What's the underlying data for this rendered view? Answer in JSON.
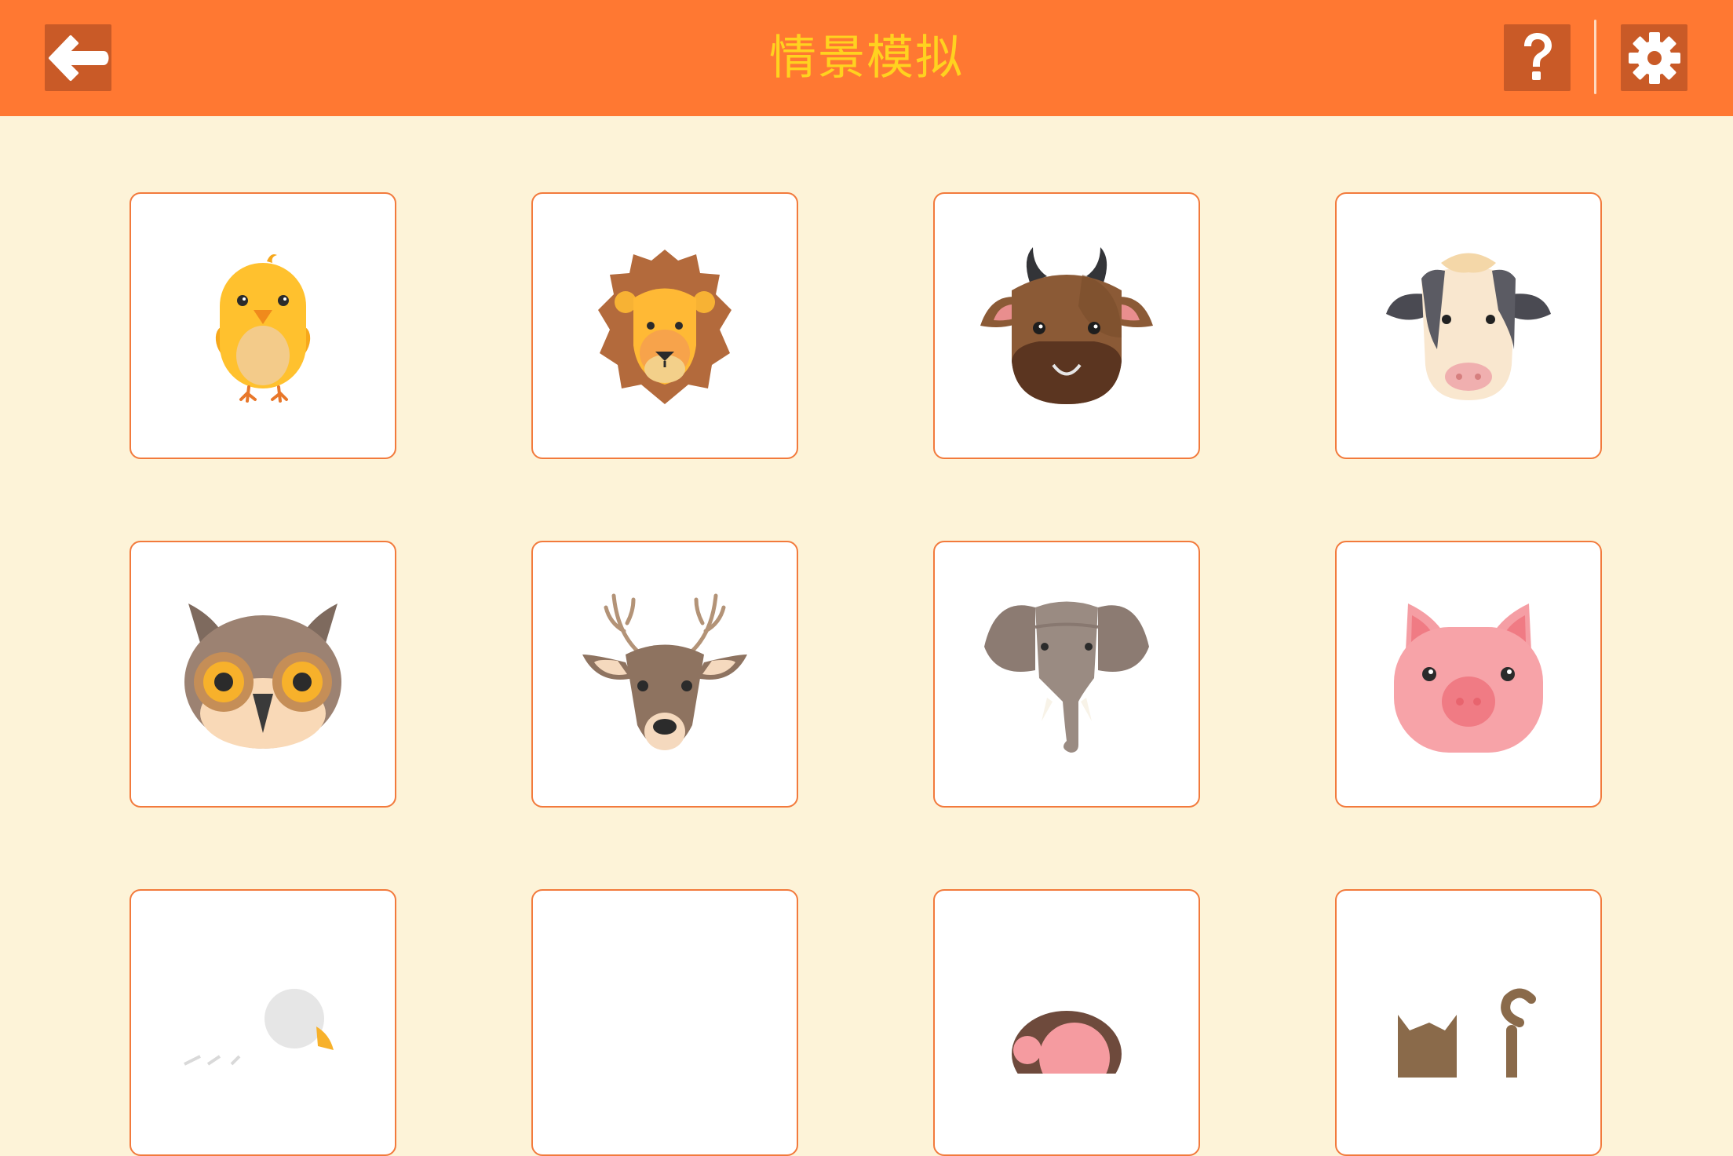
{
  "header": {
    "title": "情景模拟",
    "back_icon": "back-arrow-icon",
    "help_icon": "question-mark-icon",
    "settings_icon": "gear-icon"
  },
  "colors": {
    "header_bg": "#FF7832",
    "button_bg": "#C95A27",
    "title": "#FFD21F",
    "page_bg": "#FDF3D8",
    "card_border": "#F27A3C"
  },
  "animals": [
    {
      "id": "chick",
      "icon": "chick-icon"
    },
    {
      "id": "lion",
      "icon": "lion-icon"
    },
    {
      "id": "bull",
      "icon": "bull-icon"
    },
    {
      "id": "cow",
      "icon": "cow-icon"
    },
    {
      "id": "owl",
      "icon": "owl-icon"
    },
    {
      "id": "deer",
      "icon": "deer-icon"
    },
    {
      "id": "elephant",
      "icon": "elephant-icon"
    },
    {
      "id": "pig",
      "icon": "pig-icon"
    },
    {
      "id": "goose",
      "icon": "goose-icon"
    },
    {
      "id": "blank",
      "icon": ""
    },
    {
      "id": "monkey",
      "icon": "monkey-icon"
    },
    {
      "id": "cat",
      "icon": "cat-icon"
    }
  ]
}
